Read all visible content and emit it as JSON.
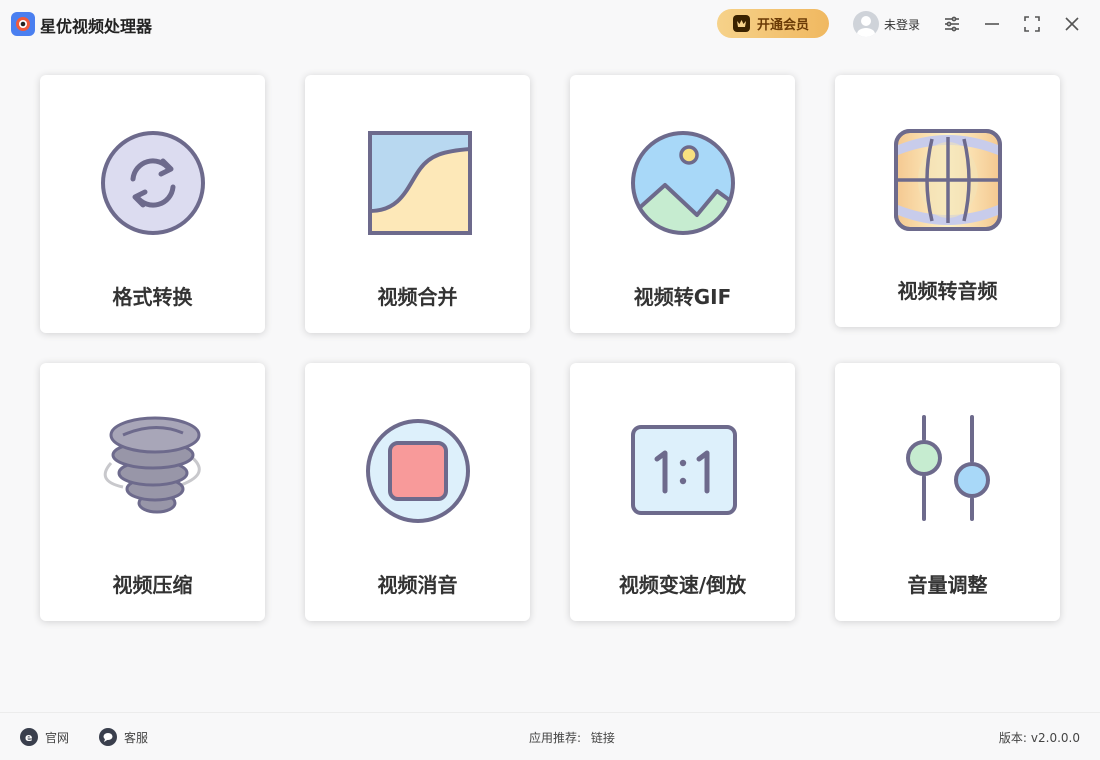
{
  "app": {
    "title": "星优视频处理器",
    "vip_label": "开通会员",
    "user_label": "未登录"
  },
  "cards": [
    {
      "label": "格式转换",
      "icon": "refresh-icon"
    },
    {
      "label": "视频合并",
      "icon": "merge-icon"
    },
    {
      "label": "视频转GIF",
      "icon": "image-icon"
    },
    {
      "label": "视频转音频",
      "icon": "audio-panel-icon"
    },
    {
      "label": "视频压缩",
      "icon": "tornado-icon"
    },
    {
      "label": "视频消音",
      "icon": "stop-icon"
    },
    {
      "label": "视频变速/倒放",
      "icon": "ratio-icon"
    },
    {
      "label": "音量调整",
      "icon": "sliders-icon"
    }
  ],
  "footer": {
    "website_label": "官网",
    "support_label": "客服",
    "recommend_label": "应用推荐:",
    "recommend_link": "链接",
    "version_label": "版本:",
    "version_value": "v2.0.0.0"
  },
  "colors": {
    "accent_gold": "#f0b860",
    "icon_stroke": "#6d6a8c",
    "lavender": "#dcdcf0",
    "light_blue": "#b8d8f0",
    "sand": "#fde8b8",
    "mint": "#c6ecd0",
    "sky": "#a8d8f8",
    "coral": "#f89a9a"
  }
}
